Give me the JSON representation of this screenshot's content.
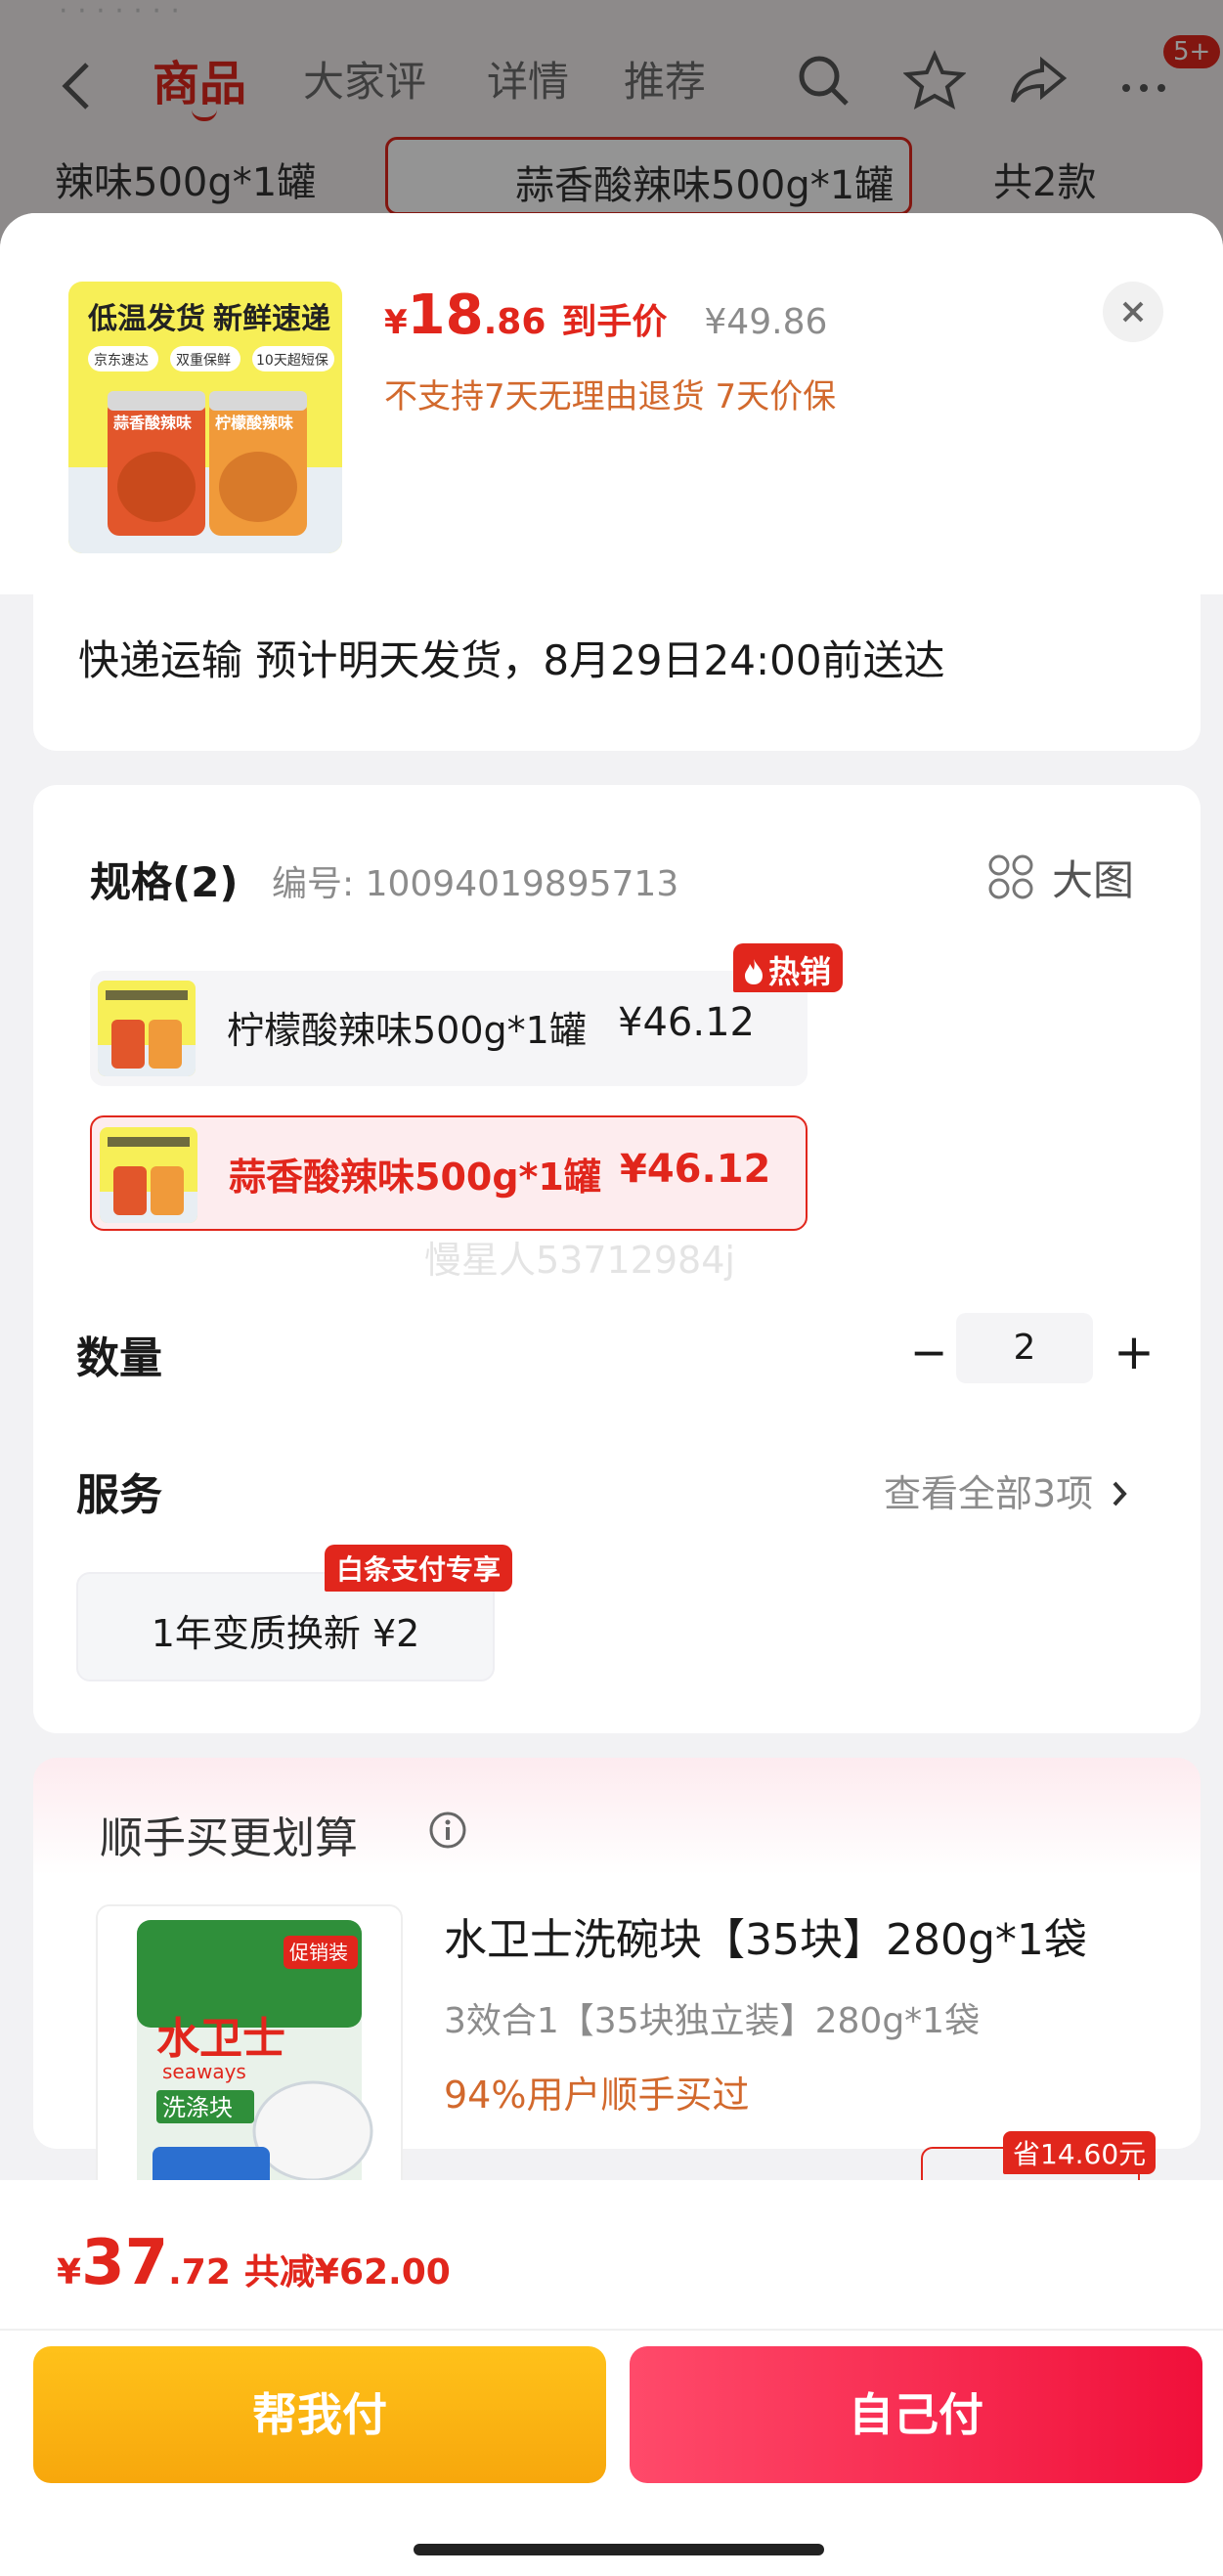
{
  "background": {
    "top_strip": "· · · · · · ·",
    "tabs": [
      "商品",
      "大家评",
      "详情",
      "推荐"
    ],
    "active_tab": "商品",
    "badge": "5+",
    "sku_items": [
      "辣味500g*1罐",
      "蒜香酸辣味500g*1罐",
      "共2款"
    ]
  },
  "product": {
    "thumb_banner_1": "低温发货",
    "thumb_banner_2": "新鲜速递",
    "thumb_tag_1": "京东速达",
    "thumb_tag_2": "双重保鲜",
    "thumb_tag_3": "10天超短保",
    "thumb_label_left": "蒜香酸辣味",
    "thumb_label_right": "柠檬酸辣味",
    "currency": "¥",
    "price_int": "18",
    "price_dec": ".86",
    "final_price_label": "到手价",
    "original_price": "¥49.86",
    "policy": "不支持7天无理由退货  7天价保"
  },
  "delivery": {
    "text": "快递运输 预计明天发货，8月29日24:00前送达"
  },
  "spec": {
    "title": "规格(2)",
    "code": "编号: 10094019895713",
    "big_image_label": "大图",
    "options": [
      {
        "name": "柠檬酸辣味500g*1罐",
        "price": "¥46.12",
        "badge": "热销",
        "selected": false
      },
      {
        "name": "蒜香酸辣味500g*1罐",
        "price": "¥46.12",
        "selected": true
      }
    ],
    "watermark": "慢星人53712984j"
  },
  "quantity": {
    "label": "数量",
    "value": "2",
    "minus": "−",
    "plus": "+"
  },
  "service": {
    "label": "服务",
    "more": "查看全部3项",
    "chip_text": "1年变质换新  ¥2",
    "chip_tag": "白条支付专享"
  },
  "recommend": {
    "title": "顺手买更划算",
    "name": "水卫士洗碗块【35块】280g*1袋",
    "spec": "3效合1【35块独立装】280g*1袋",
    "percent": "94%用户顺手买过",
    "save_badge": "省14.60元",
    "thumb_brand": "水卫士",
    "thumb_brand_en": "seaways",
    "thumb_kind": "洗涤块",
    "thumb_tag": "促销装"
  },
  "bottom": {
    "currency": "¥",
    "total_int": "37",
    "total_dec": ".72",
    "total_saved": "共减¥62.00",
    "help_pay": "帮我付",
    "self_pay": "自己付"
  },
  "colors": {
    "accent_red": "#e1261c",
    "orange_text": "#d2692d",
    "help_button": "#f9b012",
    "self_button": "#f5203f"
  }
}
